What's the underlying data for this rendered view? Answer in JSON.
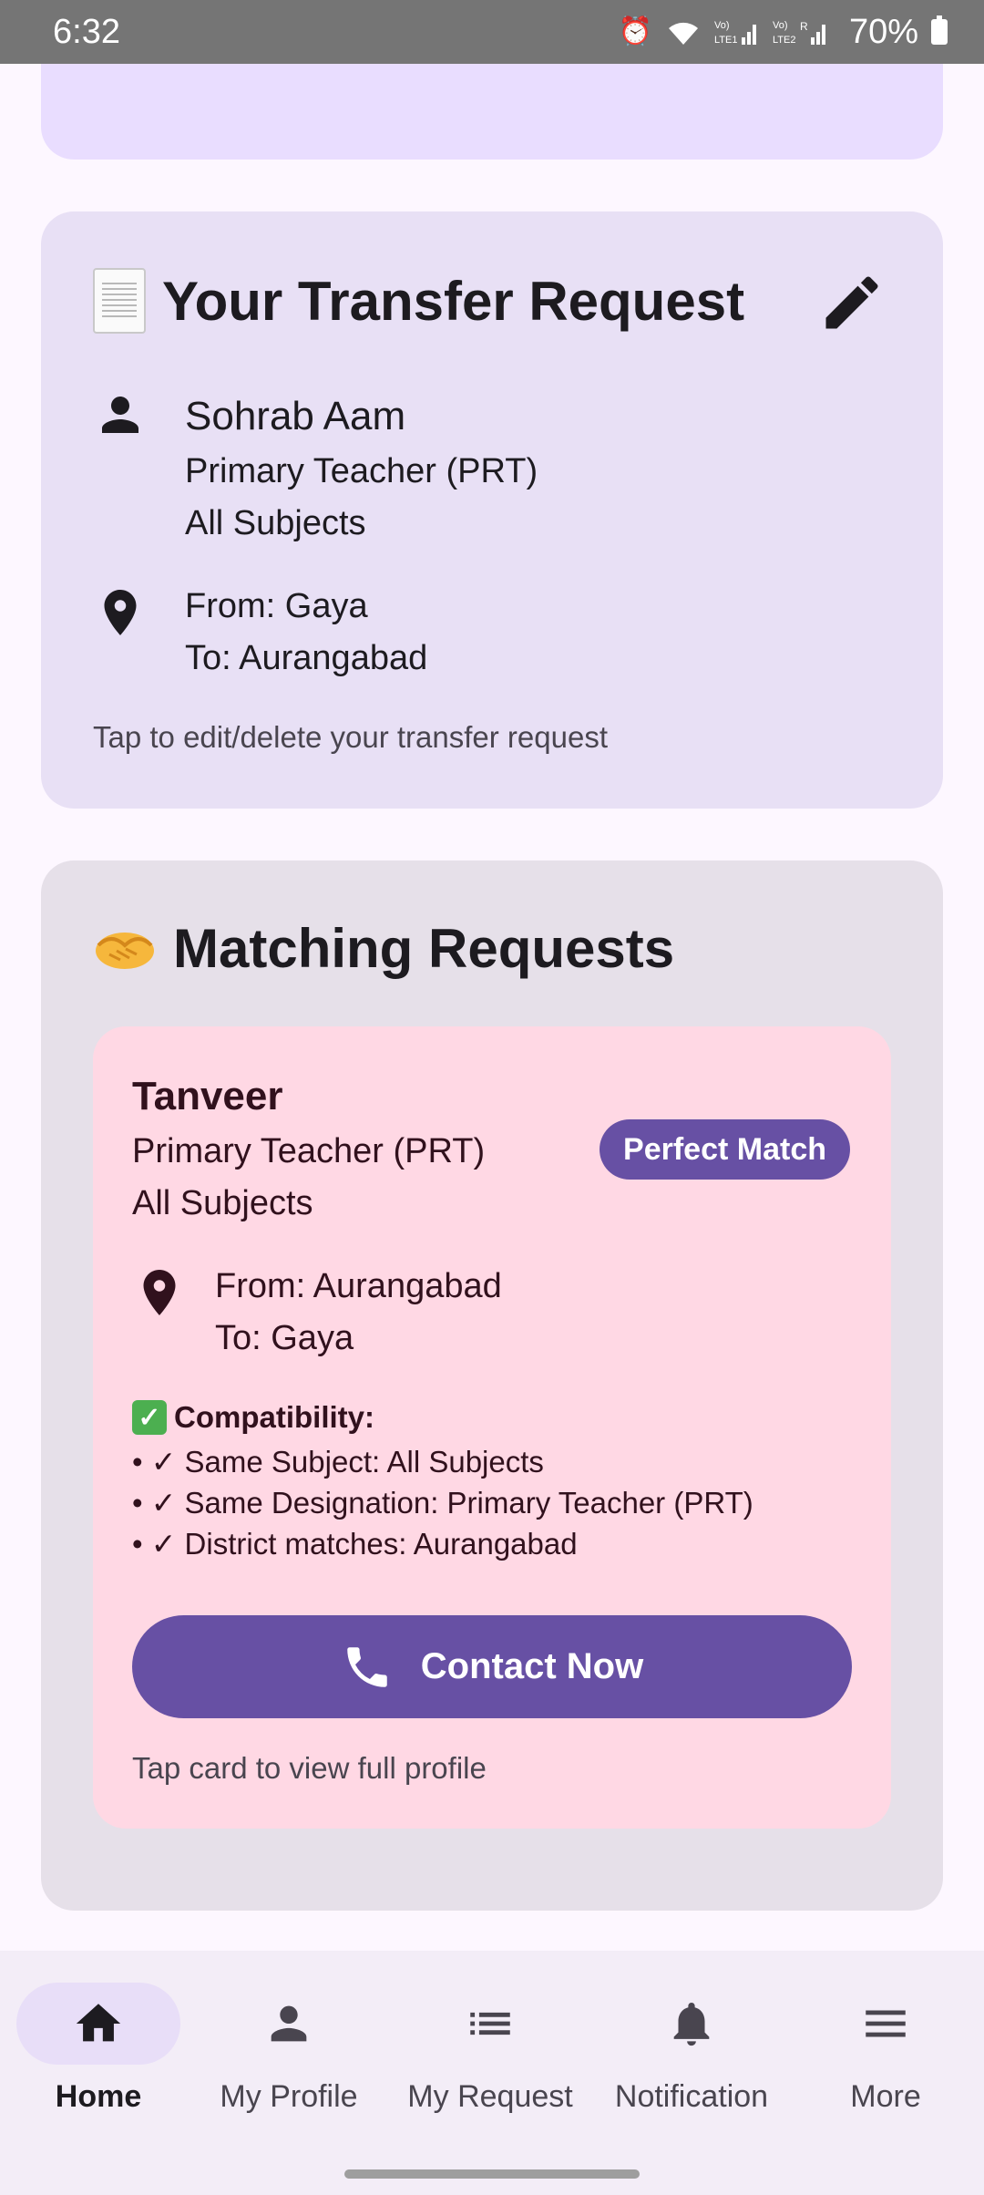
{
  "status_bar": {
    "time": "6:32",
    "battery": "70%",
    "icons": [
      "alarm-icon",
      "wifi-icon",
      "signal-lte1-icon",
      "signal-lte2-icon",
      "battery-icon"
    ]
  },
  "transfer_request": {
    "title": "Your Transfer Request",
    "title_emoji": "page-document-icon",
    "name": "Sohrab Aam",
    "designation": "Primary Teacher (PRT)",
    "subject": "All Subjects",
    "from": "From: Gaya",
    "to": "To: Aurangabad",
    "hint": "Tap to edit/delete your transfer request"
  },
  "matching_requests": {
    "title": "Matching Requests",
    "title_emoji": "handshake-icon",
    "items": [
      {
        "name": "Tanveer",
        "designation": "Primary Teacher (PRT)",
        "subject": "All Subjects",
        "badge": "Perfect Match",
        "from": "From: Aurangabad",
        "to": "To: Gaya",
        "compatibility_title": "Compatibility:",
        "compatibility": [
          "• ✓ Same Subject: All Subjects",
          "• ✓ Same Designation: Primary Teacher (PRT)",
          "• ✓ District matches: Aurangabad"
        ],
        "contact_label": "Contact Now",
        "hint": "Tap card to view full profile"
      }
    ]
  },
  "bottom_nav": {
    "items": [
      {
        "label": "Home",
        "icon": "home-icon",
        "active": true
      },
      {
        "label": "My Profile",
        "icon": "person-icon",
        "active": false
      },
      {
        "label": "My Request",
        "icon": "list-icon",
        "active": false
      },
      {
        "label": "Notification",
        "icon": "bell-icon",
        "active": false
      },
      {
        "label": "More",
        "icon": "menu-icon",
        "active": false
      }
    ]
  },
  "colors": {
    "primary": "#6750a4",
    "card_transfer": "#e8e0f5",
    "card_matching": "#e6e0e9",
    "match_card": "#ffd8e4"
  }
}
